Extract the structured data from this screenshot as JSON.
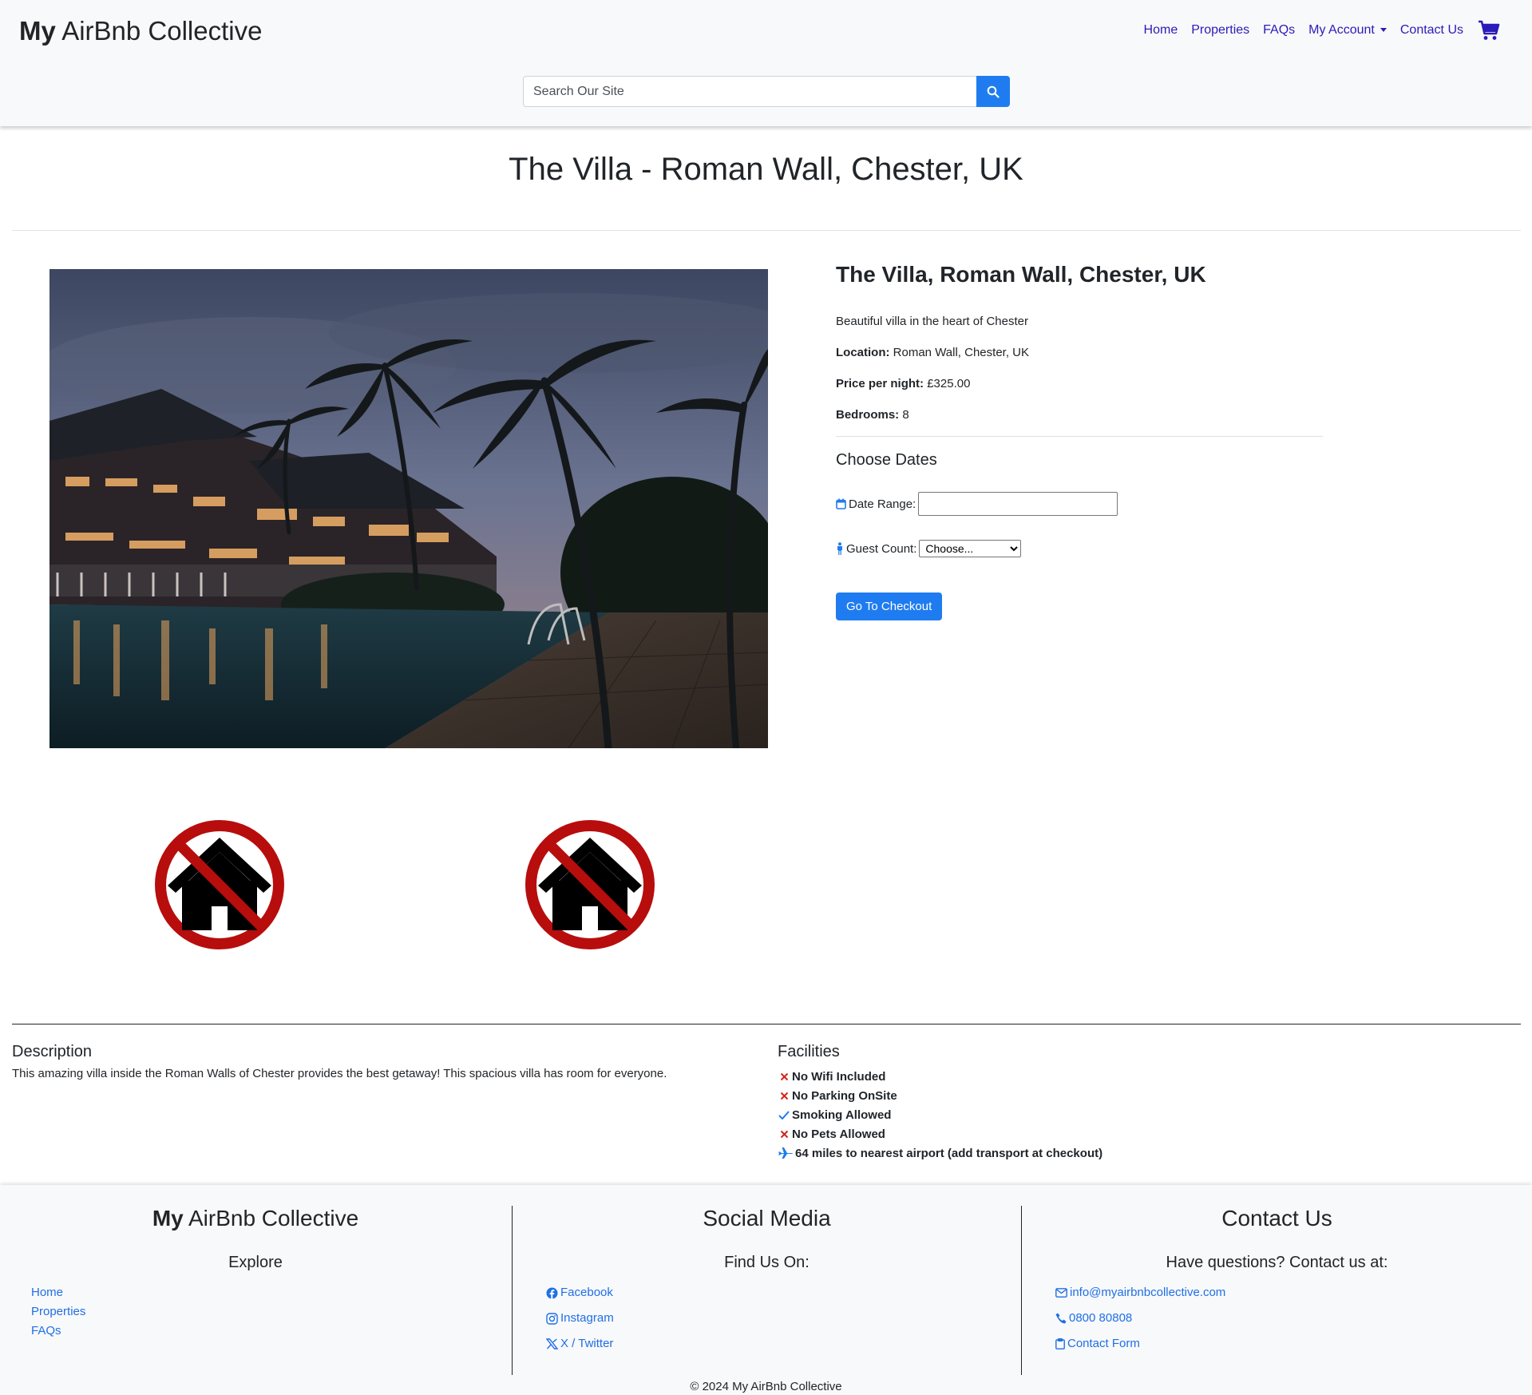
{
  "header": {
    "brand_bold": "My",
    "brand_rest": " AirBnb Collective",
    "nav": [
      "Home",
      "Properties",
      "FAQs",
      "My Account",
      "Contact Us"
    ],
    "search_placeholder": "Search Our Site",
    "link_color": "#2b1bb8",
    "accent_color": "#1f7cf0"
  },
  "page_title": "The Villa - Roman Wall, Chester, UK",
  "property": {
    "title": "The Villa, Roman Wall, Chester, UK",
    "tagline": "Beautiful villa in the heart of Chester",
    "location_label": "Location:",
    "location_value": "Roman Wall, Chester, UK",
    "price_label": "Price per night:",
    "price_value": "£325.00",
    "bedrooms_label": "Bedrooms:",
    "bedrooms_value": "8"
  },
  "booking": {
    "heading": "Choose Dates",
    "date_range_label": "Date Range:",
    "guest_count_label": "Guest Count:",
    "guest_count_selected": "Choose...",
    "checkout_button": "Go To Checkout"
  },
  "description": {
    "heading": "Description",
    "text": "This amazing villa inside the Roman Walls of Chester provides the best getaway! This spacious villa has room for everyone."
  },
  "facilities": {
    "heading": "Facilities",
    "items": [
      {
        "icon": "cross-icon",
        "text": "No Wifi Included"
      },
      {
        "icon": "cross-icon",
        "text": "No Parking OnSite"
      },
      {
        "icon": "check-icon",
        "text": "Smoking Allowed"
      },
      {
        "icon": "cross-icon",
        "text": "No Pets Allowed"
      },
      {
        "icon": "plane-icon",
        "text": "64 miles to nearest airport (add transport at checkout)"
      }
    ]
  },
  "footer": {
    "brand_bold": "My",
    "brand_rest": " AirBnb Collective",
    "explore_heading": "Explore",
    "explore_links": [
      "Home",
      "Properties",
      "FAQs"
    ],
    "social_heading": "Social Media",
    "social_sub": "Find Us On:",
    "social_links": [
      "Facebook",
      "Instagram",
      "X / Twitter"
    ],
    "contact_heading": "Contact Us",
    "contact_sub": "Have questions? Contact us at:",
    "contact_links": [
      "info@myairbnbcollective.com",
      "0800 80808",
      "Contact Form"
    ],
    "copyright": "© 2024 My AirBnb Collective"
  }
}
